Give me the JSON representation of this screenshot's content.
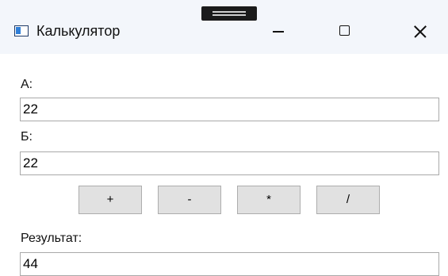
{
  "window": {
    "title": "Калькулятор"
  },
  "form": {
    "a_label": "А:",
    "a_value": "22",
    "b_label": "Б:",
    "b_value": "22",
    "result_label": "Результат:",
    "result_value": "44"
  },
  "operations": {
    "add": "+",
    "subtract": "-",
    "multiply": "*",
    "divide": "/"
  },
  "icons": {
    "app": "app-window-icon",
    "minimize": "minimize-icon",
    "maximize": "maximize-icon",
    "close": "close-icon"
  }
}
